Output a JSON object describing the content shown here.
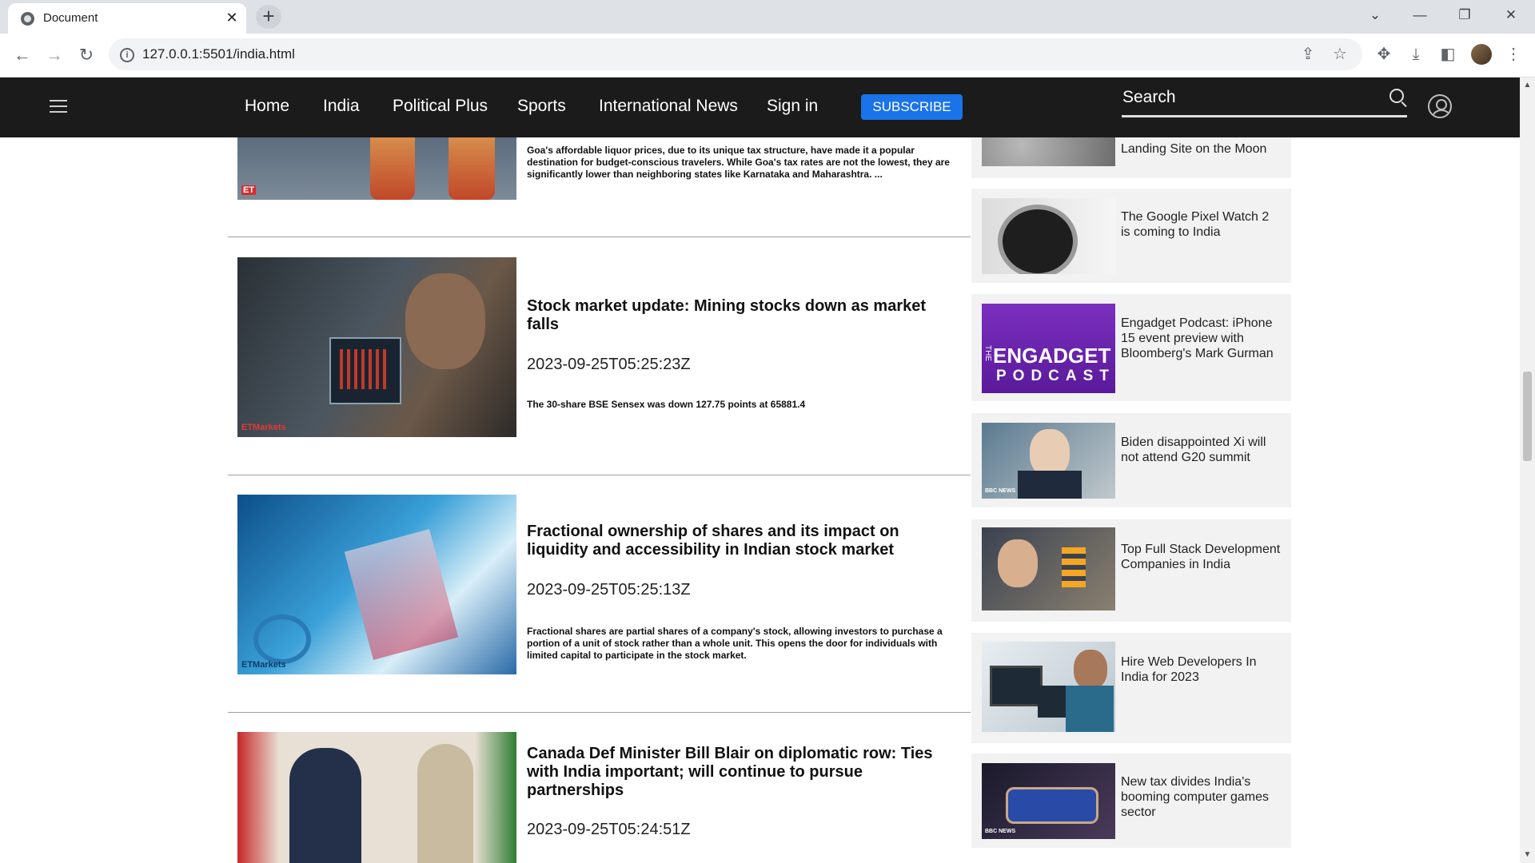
{
  "browser": {
    "tab_title": "Document",
    "url": "127.0.0.1:5501/india.html"
  },
  "nav": {
    "links": [
      "Home",
      "India",
      "Political Plus",
      "Sports",
      "International News",
      "Sign in"
    ],
    "subscribe": "SUBSCRIBE",
    "search_label": "Search"
  },
  "articles": [
    {
      "title": "",
      "date": "",
      "description": "Goa's affordable liquor prices, due to its unique tax structure, have made it a popular destination for budget-conscious travelers. While Goa's tax rates are not the lowest, they are significantly lower than neighboring states like Karnataka and Maharashtra. ...",
      "image_badge": "ET"
    },
    {
      "title": "Stock market update: Mining stocks down as market falls",
      "date": "2023-09-25T05:25:23Z",
      "description": "The 30-share BSE Sensex was down 127.75 points at 65881.4",
      "image_badge": "ETMarkets"
    },
    {
      "title": "Fractional ownership of shares and its impact on liquidity and accessibility in Indian stock market",
      "date": "2023-09-25T05:25:13Z",
      "description": "Fractional shares are partial shares of a company's stock, allowing investors to purchase a portion of a unit of stock rather than a whole unit. This opens the door for individuals with limited capital to participate in the stock market.",
      "image_badge": "ETMarkets"
    },
    {
      "title": "Canada Def Minister Bill Blair on diplomatic row: Ties with India important; will continue to pursue partnerships",
      "date": "2023-09-25T05:24:51Z",
      "description": "",
      "image_badge": ""
    }
  ],
  "sidebar": [
    {
      "title": "Landing Site on the Moon"
    },
    {
      "title": "The Google Pixel Watch 2 is coming to India"
    },
    {
      "title": "Engadget Podcast: iPhone 15 event preview with Bloomberg's Mark Gurman",
      "img_text_1": "ENGADGET",
      "img_text_2": "PODCAST",
      "img_text_3": "THE"
    },
    {
      "title": "Biden disappointed Xi will not attend G20 summit",
      "badge": "BBC NEWS"
    },
    {
      "title": "Top Full Stack Development Companies in India"
    },
    {
      "title": "Hire Web Developers In India for 2023"
    },
    {
      "title": "New tax divides India's booming computer games sector",
      "badge": "BBC NEWS"
    }
  ]
}
